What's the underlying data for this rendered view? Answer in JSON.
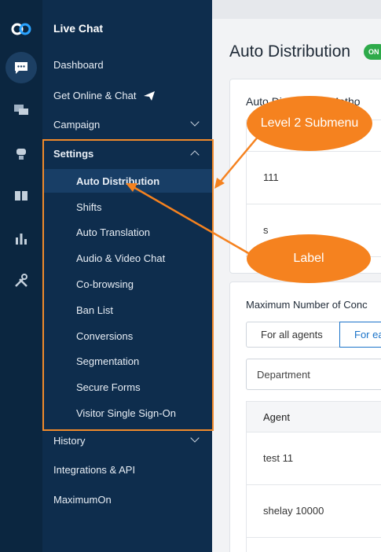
{
  "app": {
    "title": "Live Chat"
  },
  "rail": {
    "icons": [
      "logo-icon",
      "chat-bubble-icon",
      "messages-icon",
      "bot-icon",
      "book-icon",
      "bar-chart-icon",
      "tools-icon"
    ]
  },
  "menu": {
    "dashboard": "Dashboard",
    "get_online": "Get Online & Chat",
    "campaign": "Campaign",
    "settings": "Settings",
    "submenu": [
      "Auto Distribution",
      "Shifts",
      "Auto Translation",
      "Audio & Video Chat",
      "Co-browsing",
      "Ban List",
      "Conversions",
      "Segmentation",
      "Secure Forms",
      "Visitor Single Sign-On"
    ],
    "history": "History",
    "integrations": "Integrations & API",
    "maximumon": "MaximumOn"
  },
  "content": {
    "page_title": "Auto Distribution",
    "status_badge": "ON",
    "card1": {
      "title": "Auto Distribution Metho",
      "rows": [
        "111",
        "s"
      ]
    },
    "card2": {
      "title": "Maximum Number of Conc",
      "tabs": [
        "For all agents",
        "For ea"
      ],
      "select_value": "Department",
      "column_header": "Agent",
      "rows": [
        "test 11",
        "shelay 10000"
      ]
    }
  },
  "annotations": {
    "level2": "Level 2 Submenu",
    "label": "Label"
  },
  "colors": {
    "rail_bg": "#0b2640",
    "menu_bg": "#0e2d4d",
    "active_item_bg": "#183e66",
    "annotation": "#f5821f",
    "badge_green": "#2eaa4a",
    "link_blue": "#1a73c9"
  }
}
